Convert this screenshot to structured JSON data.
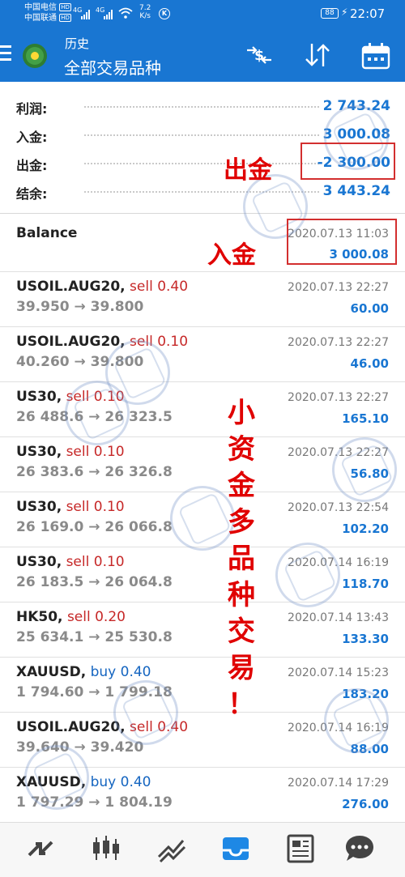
{
  "status": {
    "carrier1": "中国电信",
    "carrier2": "中国联通",
    "hd": "HD",
    "net1": "4G",
    "net2": "4G",
    "speed_value": "7.2",
    "speed_unit": "K/s",
    "k_badge": "K",
    "battery": "88",
    "time": "22:07"
  },
  "appbar": {
    "title": "历史",
    "subtitle": "全部交易品种"
  },
  "summary": [
    {
      "label": "利润:",
      "value": "2 743.24"
    },
    {
      "label": "入金:",
      "value": "3 000.08"
    },
    {
      "label": "出金:",
      "value": "-2 300.00"
    },
    {
      "label": "结余:",
      "value": "3 443.24"
    }
  ],
  "balance_entry": {
    "label": "Balance",
    "date": "2020.07.13 11:03",
    "amount": "3 000.08"
  },
  "trades": [
    {
      "symbol": "USOIL.AUG20,",
      "side": "sell",
      "volume": "0.40",
      "prices": "39.950 → 39.800",
      "date": "2020.07.13 22:27",
      "profit": "60.00"
    },
    {
      "symbol": "USOIL.AUG20,",
      "side": "sell",
      "volume": "0.10",
      "prices": "40.260 → 39.800",
      "date": "2020.07.13 22:27",
      "profit": "46.00"
    },
    {
      "symbol": "US30,",
      "side": "sell",
      "volume": "0.10",
      "prices": "26 488.6 → 26 323.5",
      "date": "2020.07.13 22:27",
      "profit": "165.10"
    },
    {
      "symbol": "US30,",
      "side": "sell",
      "volume": "0.10",
      "prices": "26 383.6 → 26 326.8",
      "date": "2020.07.13 22:27",
      "profit": "56.80"
    },
    {
      "symbol": "US30,",
      "side": "sell",
      "volume": "0.10",
      "prices": "26 169.0 → 26 066.8",
      "date": "2020.07.13 22:54",
      "profit": "102.20"
    },
    {
      "symbol": "US30,",
      "side": "sell",
      "volume": "0.10",
      "prices": "26 183.5 → 26 064.8",
      "date": "2020.07.14 16:19",
      "profit": "118.70"
    },
    {
      "symbol": "HK50,",
      "side": "sell",
      "volume": "0.20",
      "prices": "25 634.1 → 25 530.8",
      "date": "2020.07.14 13:43",
      "profit": "133.30"
    },
    {
      "symbol": "XAUUSD,",
      "side": "buy",
      "volume": "0.40",
      "prices": "1 794.60 → 1 799.18",
      "date": "2020.07.14 15:23",
      "profit": "183.20"
    },
    {
      "symbol": "USOIL.AUG20,",
      "side": "sell",
      "volume": "0.40",
      "prices": "39.640 → 39.420",
      "date": "2020.07.14 16:19",
      "profit": "88.00"
    },
    {
      "symbol": "XAUUSD,",
      "side": "buy",
      "volume": "0.40",
      "prices": "1 797.29 → 1 804.19",
      "date": "2020.07.14 17:29",
      "profit": "276.00"
    }
  ],
  "overlays": {
    "withdraw_note": "出金",
    "deposit_note": "入金",
    "vertical_note": [
      "小",
      "资",
      "金",
      "多",
      "品",
      "种",
      "交",
      "易",
      "！"
    ]
  },
  "colors": {
    "primary": "#1976d2",
    "sell": "#c62828",
    "buy": "#1565c0",
    "annotation": "#e00000"
  },
  "icons": {
    "appbar": [
      "currency-exchange-icon",
      "sort-icon",
      "calendar-icon"
    ],
    "bottomnav": [
      "quotes-icon",
      "chart-icon",
      "trade-icon",
      "history-icon",
      "news-icon",
      "chat-icon"
    ]
  }
}
